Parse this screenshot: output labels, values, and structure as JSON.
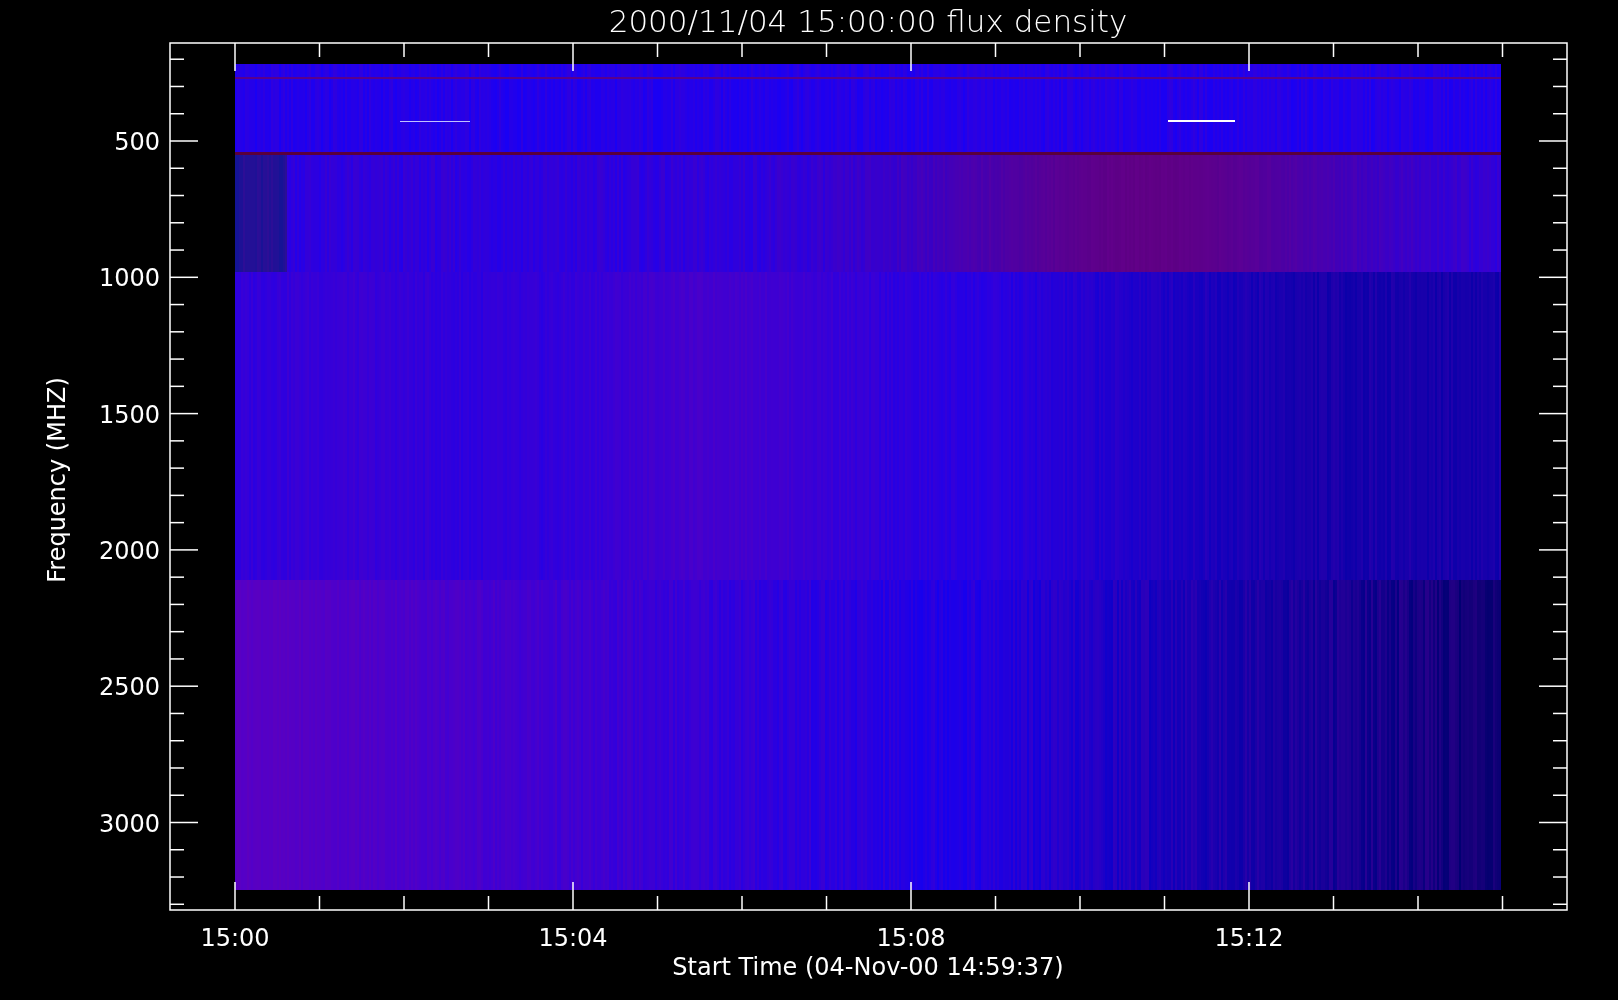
{
  "plot": {
    "title": "2000/11/04 15:00:00 flux density",
    "ylabel": "Frequency (MHZ)",
    "xlabel": "Start Time (04-Nov-00 14:59:37)",
    "xticks": [
      {
        "label": "15:00"
      },
      {
        "label": "15:04"
      },
      {
        "label": "15:08"
      },
      {
        "label": "15:12"
      }
    ],
    "yticks": [
      {
        "label": "500"
      },
      {
        "label": "1000"
      },
      {
        "label": "1500"
      },
      {
        "label": "2000"
      },
      {
        "label": "2500"
      },
      {
        "label": "3000"
      }
    ]
  }
}
